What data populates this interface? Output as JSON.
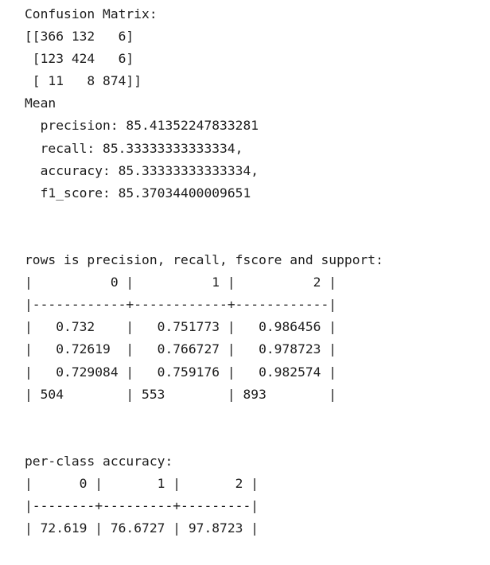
{
  "cell_output": {
    "lines": [
      "Confusion Matrix:",
      "[[366 132   6]",
      " [123 424   6]",
      " [ 11   8 874]]",
      "Mean",
      "  precision: 85.41352247833281",
      "  recall: 85.33333333333334,",
      "  accuracy: 85.33333333333334,",
      "  f1_score: 85.37034400009651",
      "",
      "",
      "rows is precision, recall, fscore and support:",
      "|          0 |          1 |          2 |",
      "|------------+------------+------------|",
      "|   0.732    |   0.751773 |   0.986456 |",
      "|   0.72619  |   0.766727 |   0.978723 |",
      "|   0.729084 |   0.759176 |   0.982574 |",
      "| 504        | 553        | 893        |",
      "",
      "",
      "per-class accuracy:",
      "|      0 |       1 |       2 |",
      "|--------+---------+---------|",
      "| 72.619 | 76.6727 | 97.8723 |"
    ]
  }
}
